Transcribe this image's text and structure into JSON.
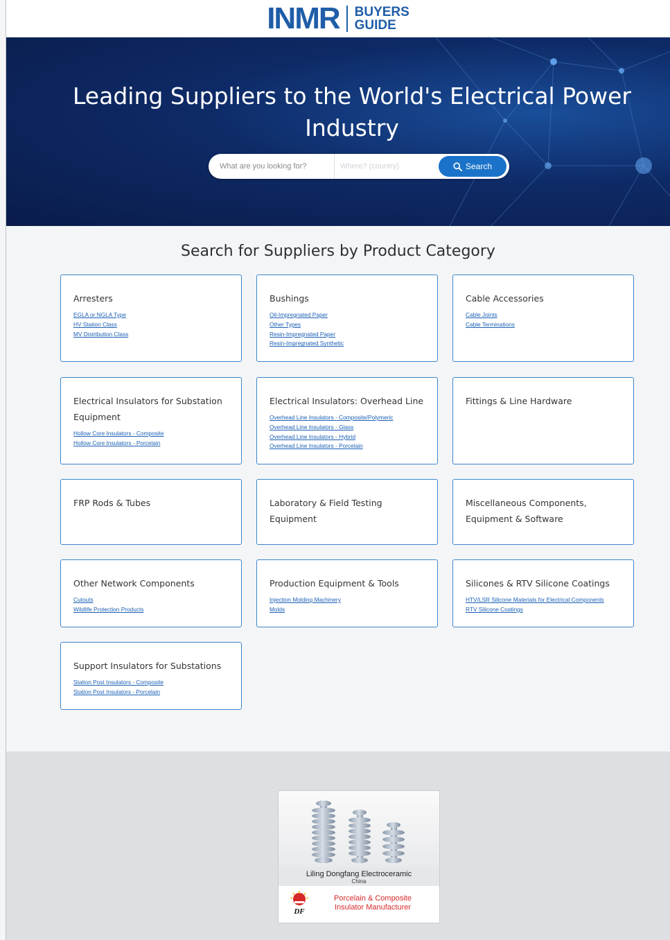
{
  "header": {
    "logo_main": "INMR",
    "logo_sub_1": "BUYERS",
    "logo_sub_2": "GUIDE"
  },
  "hero": {
    "title": "Leading Suppliers to the World's Electrical Power Industry",
    "search_what_placeholder": "What are you looking for?",
    "search_where_placeholder": "Where? (country)",
    "search_button_label": "Search"
  },
  "categories_section": {
    "title": "Search for Suppliers by Product Category",
    "cards": [
      {
        "title": "Arresters",
        "links": [
          "EGLA or NGLA Type",
          "HV Station Class",
          "MV Distribution Class"
        ]
      },
      {
        "title": "Bushings",
        "links": [
          "Oil-Impregnated Paper",
          "Other Types",
          "Resin-Impregnated Paper",
          "Resin-Impregnated Synthetic"
        ]
      },
      {
        "title": "Cable Accessories",
        "links": [
          "Cable Joints",
          "Cable Terminations"
        ]
      },
      {
        "title": "Electrical Insulators for Substation Equipment",
        "links": [
          "Hollow Core Insulators - Composite",
          "Hollow Core Insulators - Porcelain"
        ]
      },
      {
        "title": "Electrical Insulators: Overhead Line",
        "links": [
          "Overhead Line Insulators - Composite/Polymeric",
          "Overhead Line Insulators - Glass",
          "Overhead Line Insulators - Hybrid",
          "Overhead Line Insulators - Porcelain"
        ]
      },
      {
        "title": "Fittings & Line Hardware",
        "links": []
      },
      {
        "title": "FRP Rods & Tubes",
        "links": []
      },
      {
        "title": "Laboratory & Field Testing Equipment",
        "links": []
      },
      {
        "title": "Miscellaneous Components, Equipment & Software",
        "links": []
      },
      {
        "title": "Other Network Components",
        "links": [
          "Cutouts",
          "Wildlife Protection Products"
        ]
      },
      {
        "title": "Production Equipment & Tools",
        "links": [
          "Injection Molding Machinery",
          "Molds"
        ]
      },
      {
        "title": "Silicones & RTV Silicone Coatings",
        "links": [
          "HTV/LSR Silicone Materials for Electrical Components",
          "RTV Silicone Coatings"
        ]
      },
      {
        "title": "Support Insulators for Substations",
        "links": [
          "Station Post Insulators - Composite",
          "Station Post Insulators - Porcelain"
        ]
      }
    ]
  },
  "footer_ad": {
    "company": "Liling Dongfang Electroceramic",
    "country": "China",
    "logo_text": "DF",
    "tagline_1": "Porcelain & Composite",
    "tagline_2": "Insulator Manufacturer"
  },
  "colors": {
    "brand_blue": "#1f5da8",
    "card_border": "#3b86cc",
    "link_blue": "#1a5fb4",
    "search_button": "#1a73c9",
    "ad_red": "#d62828"
  }
}
